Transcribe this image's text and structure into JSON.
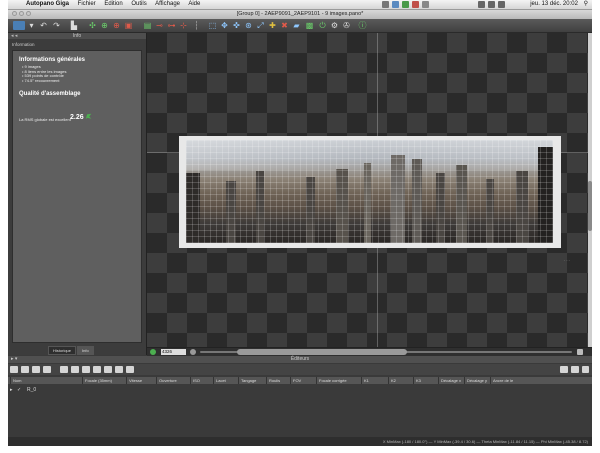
{
  "menubar": {
    "app_name": "Autopano Giga",
    "menus": [
      "Fichier",
      "Edition",
      "Outils",
      "Affichage",
      "Aide"
    ],
    "clock": "jeu. 13 déc.  20:02"
  },
  "window": {
    "title": "[Group 0] - 2AEP9091_2AEP9101 - 9 images.pano*"
  },
  "left_panel": {
    "header_title": "Info",
    "label": "Information",
    "general_title": "Informations générales",
    "general_items": [
      "• 9 images",
      "• 8 liens entre les images",
      "• 539 points de contrôle",
      "• 74.5° recouvrement"
    ],
    "quality_title": "Qualité d'assemblage",
    "rms_label": "La RMS globale est excellent",
    "rms_value": "2.26",
    "tabs": [
      "Historique",
      "Info"
    ],
    "active_tab": "Info"
  },
  "canvas": {
    "corner_label": "- - -"
  },
  "zoombar": {
    "zoom_value": "4326"
  },
  "bottom_panel": {
    "header_title": "Éditeurs",
    "columns": [
      "Nom",
      "Focale (35mm)",
      "Vitesse",
      "Ouverture",
      "ISO",
      "Lacet",
      "Tangage",
      "Roulis",
      "FOV",
      "Focale corrigée",
      "K1",
      "K2",
      "K3",
      "Décalage x",
      "Décalage y",
      "Ancre de le"
    ],
    "row": {
      "check": "✓",
      "name": "R_0"
    },
    "status_text": "X MinMax (-180 / 180.0°)  —  Y MinMax (-39.4 / 30.6)  —  Theta MinMax (-11.84 / 11.15)  —  Phi MinMax (-45.38 / 8.72)"
  },
  "colors": {
    "accent_green": "#4caf50",
    "canvas_dark": "#2a2a2a",
    "panel_gray": "#5f5f5f"
  }
}
